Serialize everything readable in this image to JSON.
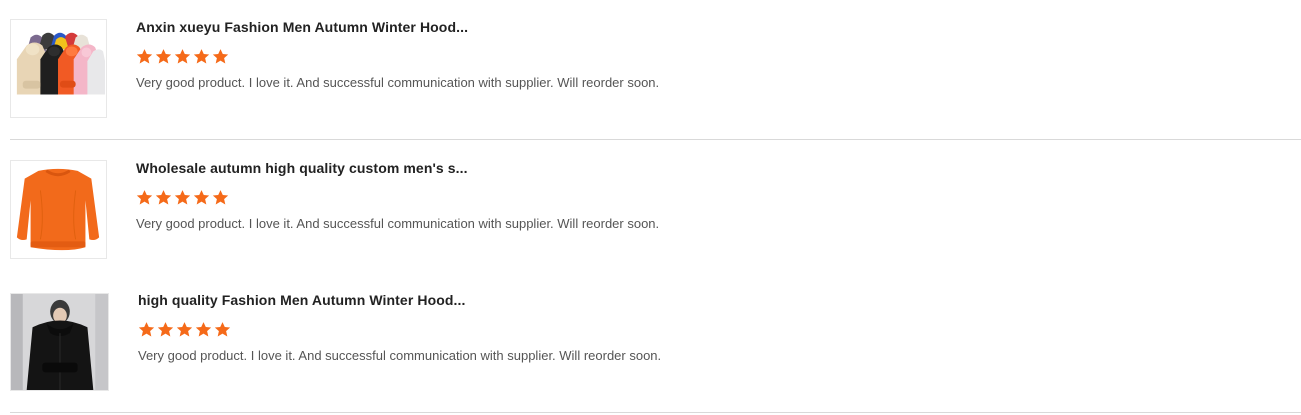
{
  "reviews": [
    {
      "title": "Anxin xueyu Fashion Men Autumn Winter Hood...",
      "rating": 5,
      "text": "Very good product. I love it. And successful communication with supplier. Will reorder soon.",
      "thumbnail": "hoodies-multicolor"
    },
    {
      "title": "Wholesale autumn high quality custom men's s...",
      "rating": 5,
      "text": "Very good product. I love it. And successful communication with supplier. Will reorder soon.",
      "thumbnail": "orange-sweatshirt"
    },
    {
      "title": "high quality Fashion Men Autumn Winter Hood...",
      "rating": 5,
      "text": "Very good product. I love it. And successful communication with supplier. Will reorder soon.",
      "thumbnail": "black-hoodie-model"
    }
  ],
  "colors": {
    "star": "#f56a19",
    "divider": "#d9d9d9",
    "title": "#222222",
    "text": "#555555"
  }
}
